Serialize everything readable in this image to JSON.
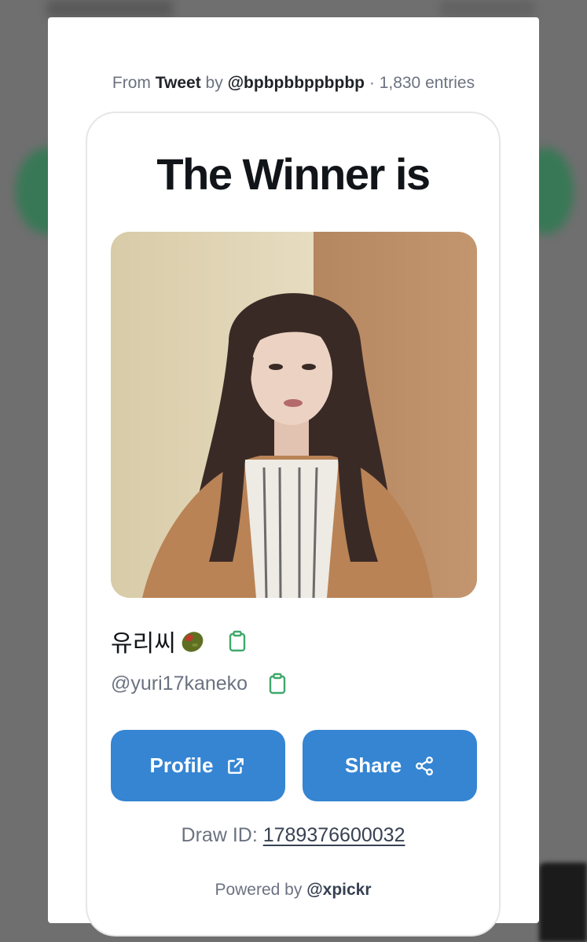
{
  "source": {
    "prefix": "From",
    "kind": "Tweet",
    "by": "by",
    "author": "@bpbpbbppbpbp",
    "separator": "·",
    "entries": "1,830 entries"
  },
  "card": {
    "title": "The Winner is",
    "winner": {
      "display_name": "유리씨",
      "handle": "@yuri17kaneko"
    },
    "buttons": {
      "profile_label": "Profile",
      "share_label": "Share"
    },
    "draw_id_label": "Draw ID:",
    "draw_id_value": "1789376600032",
    "powered_by_label": "Powered by",
    "powered_by_handle": "@xpickr"
  },
  "icons": {
    "copy": "clipboard-icon",
    "external": "external-link-icon",
    "share": "share-icon",
    "emoji": "olive-icon"
  },
  "colors": {
    "accent": "#3585d3",
    "copy_icon": "#3fa86a",
    "title": "#111418",
    "muted": "#6b7280"
  }
}
